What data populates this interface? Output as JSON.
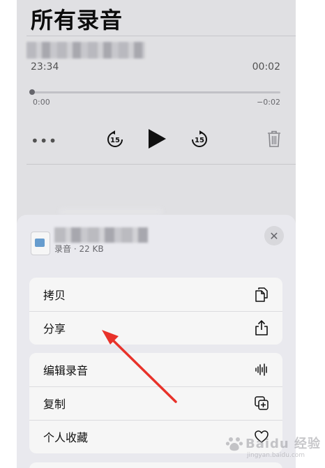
{
  "page": {
    "title": "所有录音"
  },
  "recording": {
    "time": "23:34",
    "duration": "00:02",
    "position_label": "0:00",
    "remaining_label": "−0:02",
    "progress": 0.0,
    "skip_seconds": "15"
  },
  "sheet": {
    "subtitle": "录音 · 22 KB",
    "close_glyph": "✕",
    "group1": [
      {
        "label": "拷贝",
        "icon": "copy-icon"
      },
      {
        "label": "分享",
        "icon": "share-icon"
      }
    ],
    "group2": [
      {
        "label": "编辑录音",
        "icon": "waveform-icon"
      },
      {
        "label": "复制",
        "icon": "duplicate-icon"
      },
      {
        "label": "个人收藏",
        "icon": "heart-icon"
      }
    ]
  },
  "watermark": {
    "text": "Baidu 经验",
    "url": "jingyan.baidu.com"
  },
  "colors": {
    "annotation_arrow": "#e8322a",
    "accent": "#111111"
  }
}
